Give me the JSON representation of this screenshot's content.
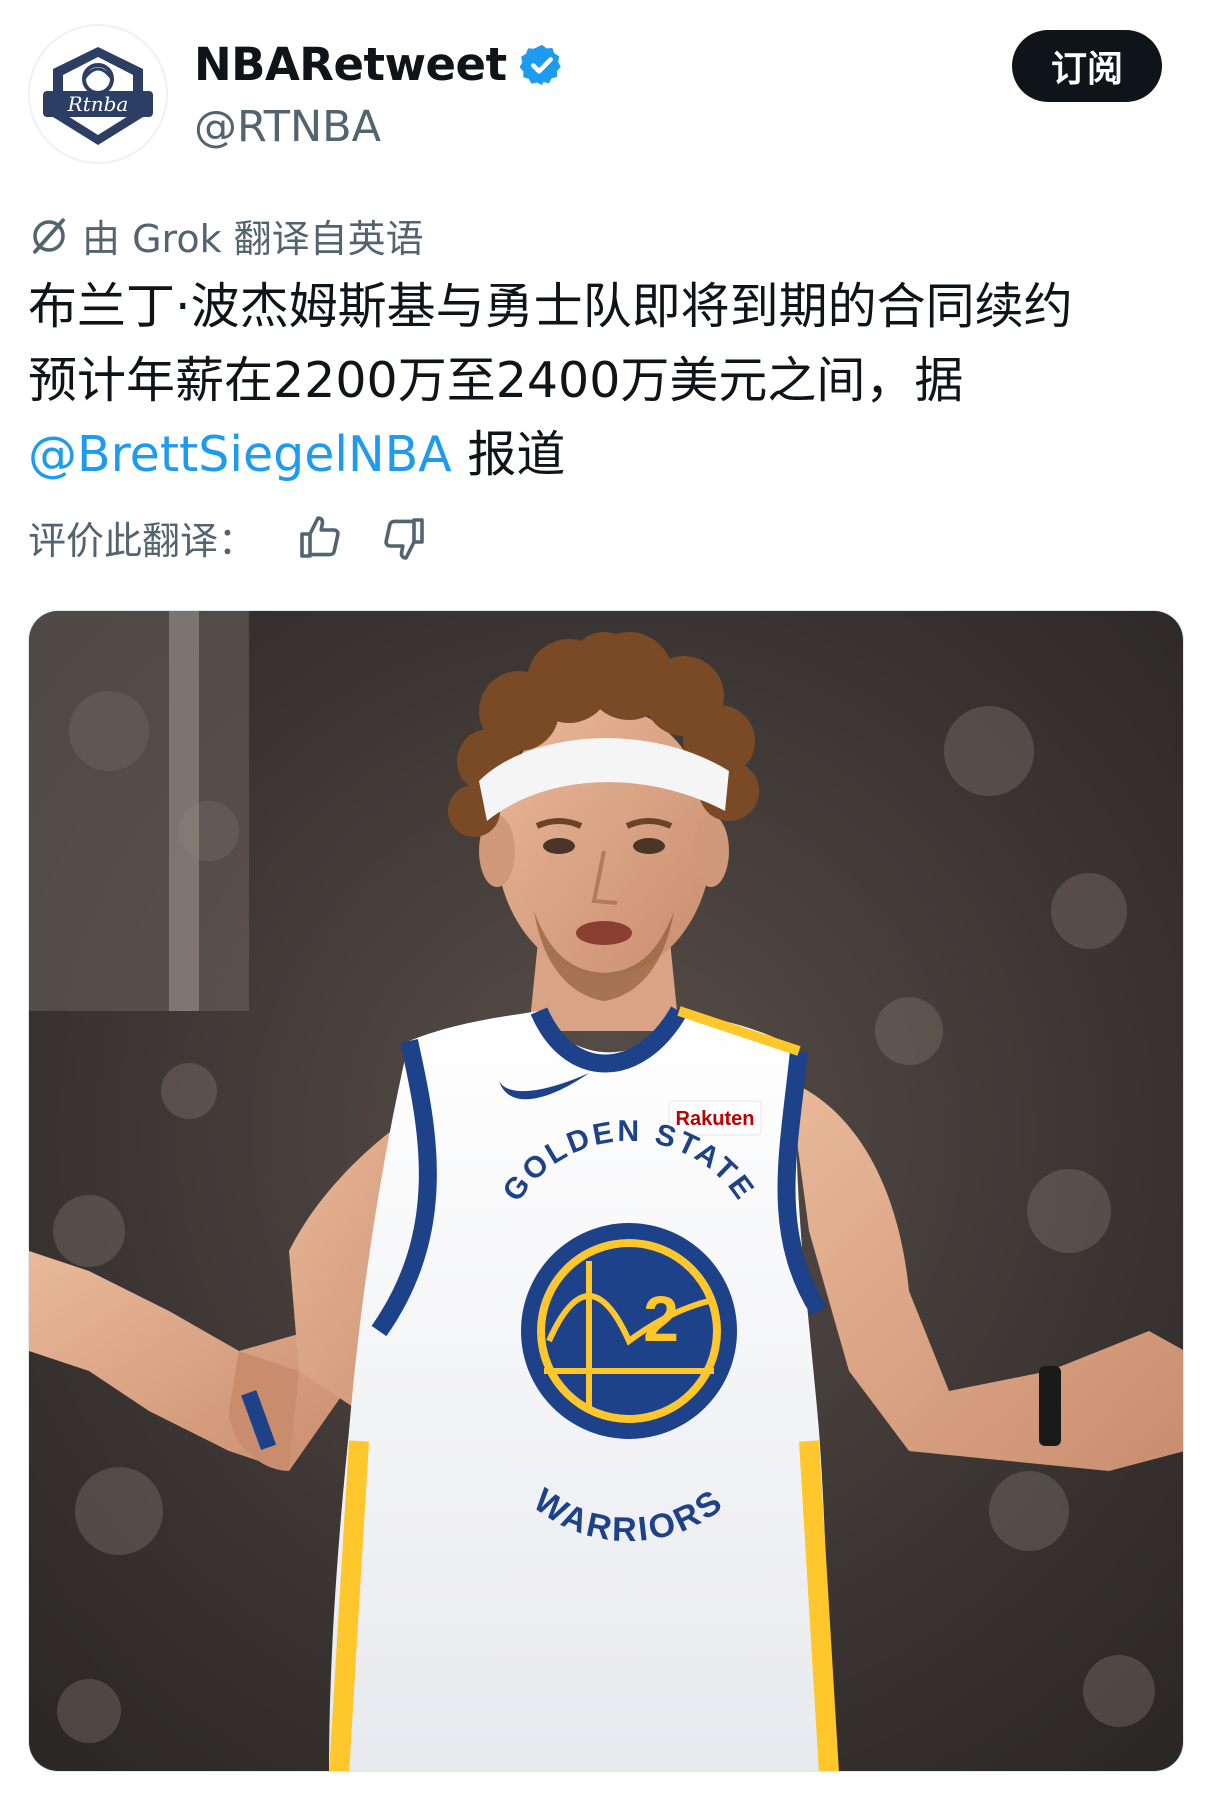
{
  "header": {
    "display_name": "NBARetweet",
    "handle": "@RTNBA",
    "subscribe_label": "订阅",
    "avatar_text": "Rtnba",
    "avatar_icon": "rtnba-basketball-logo"
  },
  "translation": {
    "note": "由 Grok 翻译自英语",
    "icon": "grok-icon"
  },
  "tweet": {
    "line1": "布兰丁·波杰姆斯基与勇士队即将到期的合同续约",
    "line2": "预计年薪在2200万至2400万美元之间，据",
    "mention": "@BrettSiegelNBA",
    "line3_suffix": " 报道"
  },
  "rating": {
    "label": "评价此翻译：",
    "like_icon": "thumbs-up-icon",
    "dislike_icon": "thumbs-down-icon"
  },
  "media": {
    "description_icon": "player-photo",
    "jersey_team_top": "GOLDEN STATE",
    "jersey_team_bottom": "WARRIORS",
    "jersey_number": "2",
    "jersey_sponsor": "Rakuten"
  },
  "colors": {
    "accent": "#1d9bf0",
    "text_primary": "#0f1419",
    "text_secondary": "#536471",
    "warriors_blue": "#1d428a",
    "warriors_gold": "#ffc72c"
  }
}
